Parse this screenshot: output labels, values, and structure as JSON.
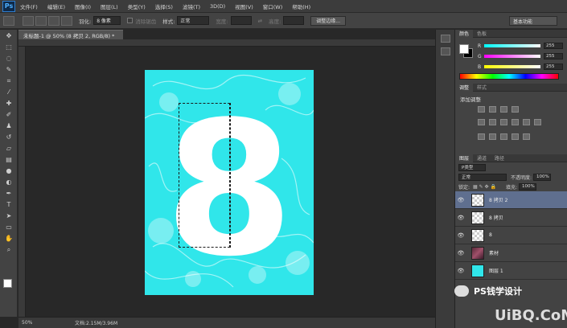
{
  "app": {
    "logo": "Ps"
  },
  "menu": [
    "文件(F)",
    "编辑(E)",
    "图像(I)",
    "图层(L)",
    "类型(Y)",
    "选择(S)",
    "滤镜(T)",
    "3D(D)",
    "视图(V)",
    "窗口(W)",
    "帮助(H)"
  ],
  "options": {
    "feather_label": "羽化:",
    "feather_value": "8 像素",
    "antialias_label": "消除锯齿",
    "style_label": "样式:",
    "style_value": "正常",
    "width_label": "宽度:",
    "height_label": "高度:",
    "refine_edge": "调整边缘...",
    "workspace": "基本功能"
  },
  "document": {
    "tab_title": "未标题-1 @ 50% (8 拷贝 2, RGB/8) *",
    "zoom": "50%",
    "doc_size": "文档:2.15M/3.96M"
  },
  "color_panel": {
    "tabs": [
      "颜色",
      "色板"
    ],
    "r_label": "R",
    "g_label": "G",
    "b_label": "B",
    "r_value": "255",
    "g_value": "255",
    "b_value": "255"
  },
  "adjust_panel": {
    "tabs": [
      "调整",
      "样式"
    ],
    "title": "添加调整"
  },
  "layers_panel": {
    "tabs": [
      "图层",
      "通道",
      "路径"
    ],
    "filter": "P类型",
    "blend_mode": "正常",
    "opacity_label": "不透明度:",
    "opacity_value": "100%",
    "lock_label": "锁定:",
    "fill_label": "填充:",
    "fill_value": "100%",
    "layers": [
      {
        "name": "8 拷贝 2",
        "thumb": "checker",
        "selected": true
      },
      {
        "name": "8 拷贝",
        "thumb": "checker",
        "selected": false
      },
      {
        "name": "8",
        "thumb": "checker",
        "selected": false
      },
      {
        "name": "素材",
        "thumb": "photo",
        "selected": false
      },
      {
        "name": "图层 1",
        "thumb": "cyan",
        "selected": false
      }
    ]
  },
  "watermark": {
    "text": "PS钱学设计",
    "site": "UiBQ.CoM"
  },
  "colors": {
    "canvas": "#30e6ea",
    "glyph": "#ffffff"
  },
  "canvas_text": "8"
}
